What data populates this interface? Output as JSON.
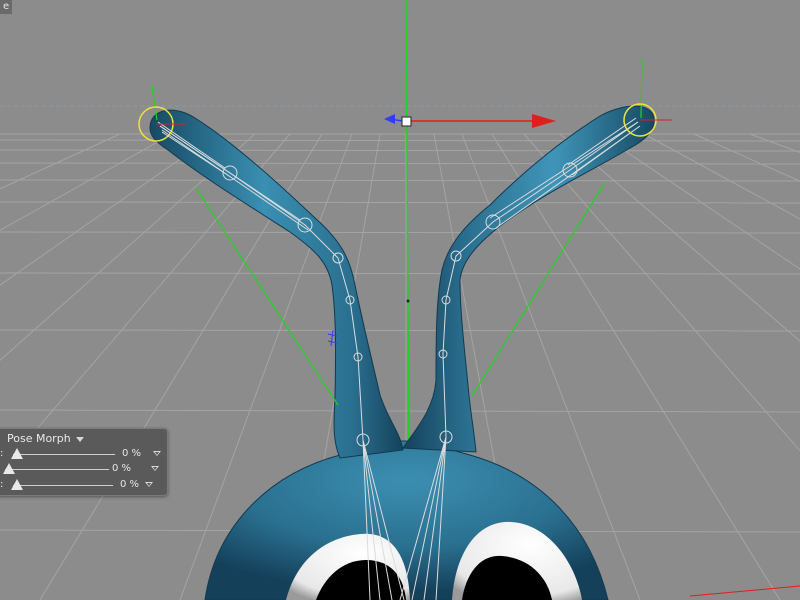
{
  "viewport": {
    "corner_label": "e"
  },
  "morph_panel": {
    "title": "Pose Morph",
    "rows": [
      {
        "label": ":",
        "value": "0 %",
        "fraction": 0
      },
      {
        "label": "",
        "value": "0 %",
        "fraction": 0
      },
      {
        "label": ":",
        "value": "0 %",
        "fraction": 0
      }
    ]
  },
  "colors": {
    "background": "#8c8c8c",
    "grid": "#a4a4a4",
    "horizon": "#7f9bb0",
    "character_body": "#2a6f8f",
    "axis_x": "#e01e1e",
    "axis_y": "#21d321",
    "axis_z": "#2f3cff",
    "joint_selected": "#f0e23c"
  },
  "icons": {
    "axis_handle": "move-axis-icon",
    "dropdown": "chevron-down-icon"
  }
}
